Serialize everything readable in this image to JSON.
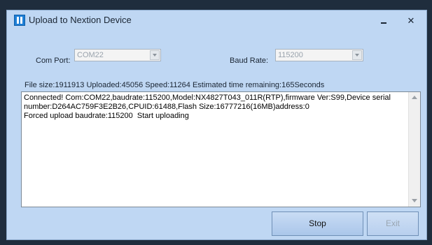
{
  "window": {
    "title": "Upload to Nextion Device",
    "minimize_glyph": "—",
    "close_glyph": "✕"
  },
  "form": {
    "com_port_label": "Com Port:",
    "com_port_value": "COM22",
    "baud_rate_label": "Baud Rate:",
    "baud_rate_value": "115200"
  },
  "status": {
    "text": "File size:1911913 Uploaded:45056 Speed:11264 Estimated time remaining:165Seconds"
  },
  "log": {
    "lines": "Connected! Com:COM22,baudrate:115200,Model:NX4827T043_011R(RTP),firmware Ver:S99,Device serial number:D264AC759F3E2B26,CPUID:61488,Flash Size:16777216(16MB)address:0\nForced upload baudrate:115200  Start uploading"
  },
  "buttons": {
    "stop": "Stop",
    "exit": "Exit"
  },
  "icons": {
    "app": "nextion-logo-icon",
    "dropdown": "chevron-down-icon"
  }
}
